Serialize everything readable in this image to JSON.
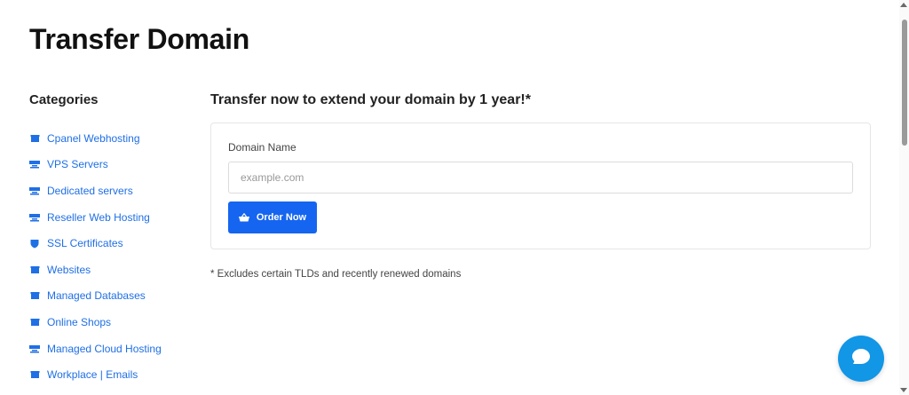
{
  "page": {
    "title": "Transfer Domain"
  },
  "sidebar": {
    "heading": "Categories",
    "items": [
      {
        "label": "Cpanel Webhosting",
        "icon": "box-icon"
      },
      {
        "label": "VPS Servers",
        "icon": "server-icon"
      },
      {
        "label": "Dedicated servers",
        "icon": "server-icon"
      },
      {
        "label": "Reseller Web Hosting",
        "icon": "server-icon"
      },
      {
        "label": "SSL Certificates",
        "icon": "shield-icon"
      },
      {
        "label": "Websites",
        "icon": "box-icon"
      },
      {
        "label": "Managed Databases",
        "icon": "box-icon"
      },
      {
        "label": "Online Shops",
        "icon": "box-icon"
      },
      {
        "label": "Managed Cloud Hosting",
        "icon": "server-icon"
      },
      {
        "label": "Workplace | Emails",
        "icon": "box-icon"
      }
    ]
  },
  "main": {
    "heading": "Transfer now to extend your domain by 1 year!*",
    "form": {
      "label": "Domain Name",
      "placeholder": "example.com",
      "value": "",
      "button_label": "Order Now",
      "button_icon": "basket-icon"
    },
    "footnote": "* Excludes certain TLDs and recently renewed domains"
  },
  "chat": {
    "icon": "chat-bubble-icon"
  },
  "colors": {
    "accent": "#1565f0",
    "link": "#1f6fe5",
    "chat": "#1296e6"
  }
}
